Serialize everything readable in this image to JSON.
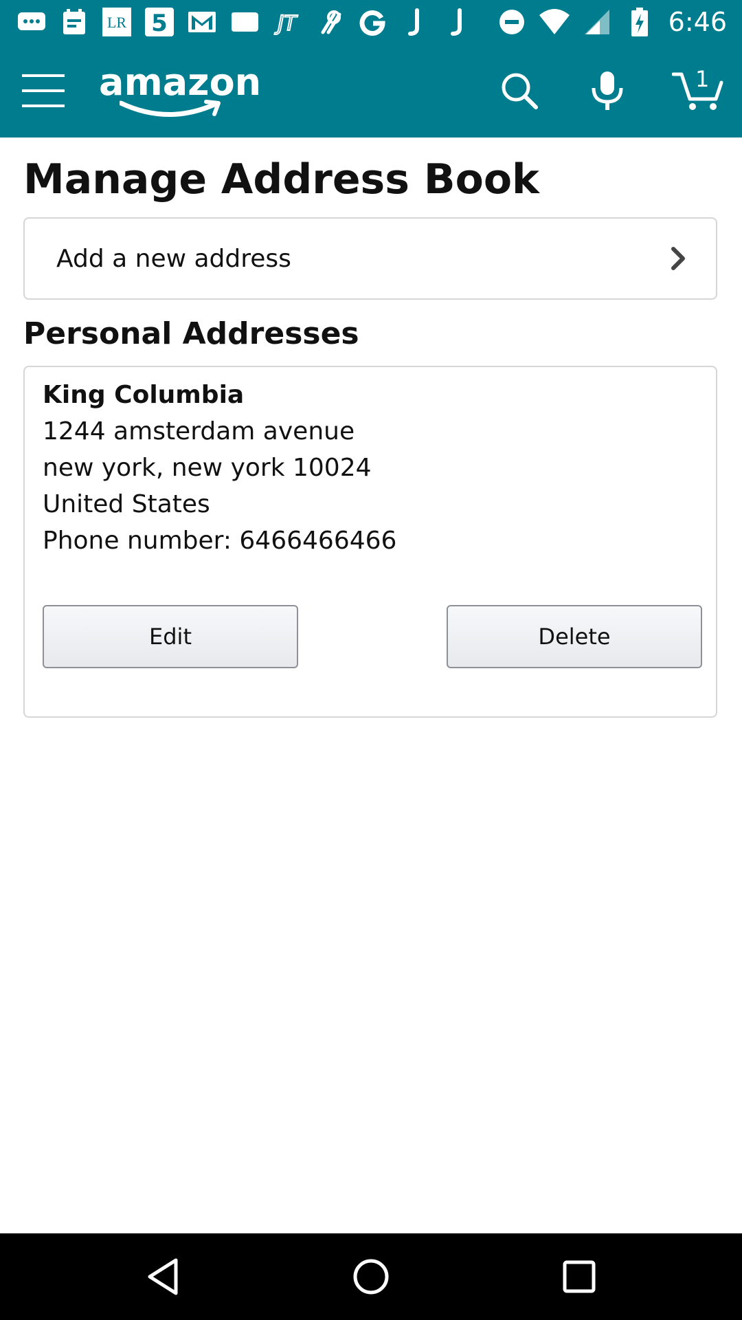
{
  "status_bar": {
    "time": "6:46",
    "left_icons": [
      "messages-icon",
      "calendar-icon",
      "lr-icon",
      "five-icon",
      "gmail-icon",
      "tag-icon",
      "jt-icon",
      "link-icon",
      "google-icon",
      "j-icon",
      "j-icon"
    ],
    "right_icons": [
      "dnd-icon",
      "wifi-icon",
      "signal-icon",
      "battery-charging-icon"
    ]
  },
  "header": {
    "logo_text": "amazon",
    "cart_count": "1",
    "bg_color": "#007c8f"
  },
  "page": {
    "title": "Manage Address Book",
    "add_address_label": "Add a new address",
    "section_title": "Personal Addresses"
  },
  "address": {
    "name": "King Columbia",
    "street": "1244 amsterdam avenue",
    "city_line": "new york, new york 10024",
    "country": "United States",
    "phone": "Phone number: 6466466466",
    "edit_label": "Edit",
    "delete_label": "Delete"
  },
  "nav_bar": {
    "icons": [
      "back-icon",
      "home-icon",
      "recents-icon"
    ]
  }
}
